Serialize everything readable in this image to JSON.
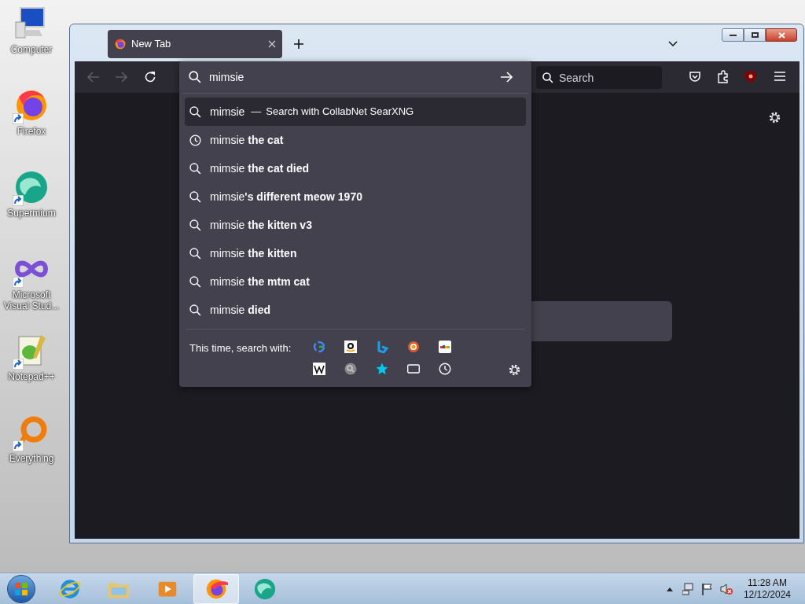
{
  "desktop_icons": [
    {
      "label": "Computer",
      "kind": "computer"
    },
    {
      "label": "Firefox",
      "kind": "firefox"
    },
    {
      "label": "Supermium",
      "kind": "supermium"
    },
    {
      "label": "Microsoft Visual Stud...",
      "kind": "vs"
    },
    {
      "label": "Notepad++",
      "kind": "notepad"
    },
    {
      "label": "Everything",
      "kind": "everything"
    }
  ],
  "browser": {
    "tab": {
      "title": "New Tab",
      "selected": true
    },
    "urlbar": {
      "value": "mimsie"
    },
    "search_field": {
      "placeholder": "Search"
    },
    "suggestions": [
      {
        "kind": "engine",
        "text": "mimsie",
        "separator": "—",
        "action": "Search with CollabNet SearXNG",
        "selected": true
      },
      {
        "kind": "history",
        "text": "mimsie **the cat**",
        "selected": false
      },
      {
        "kind": "search",
        "text": "mimsie **the cat died**",
        "selected": false
      },
      {
        "kind": "search",
        "text": "mimsie**'s different meow 1970**",
        "selected": false
      },
      {
        "kind": "search",
        "text": "mimsie **the kitten v3**",
        "selected": false
      },
      {
        "kind": "search",
        "text": "mimsie **the kitten**",
        "selected": false
      },
      {
        "kind": "search",
        "text": "mimsie **the mtm cat**",
        "selected": false
      },
      {
        "kind": "search",
        "text": "mimsie **died**",
        "selected": false
      }
    ],
    "one_off_label": "This time, search with:"
  },
  "taskbar": {
    "apps": [
      {
        "kind": "ie",
        "selected": false
      },
      {
        "kind": "explorer",
        "selected": false
      },
      {
        "kind": "media",
        "selected": false
      },
      {
        "kind": "firefox",
        "selected": true
      },
      {
        "kind": "supermium",
        "selected": false
      }
    ],
    "time": "11:28 AM",
    "date": "12/12/2024"
  }
}
